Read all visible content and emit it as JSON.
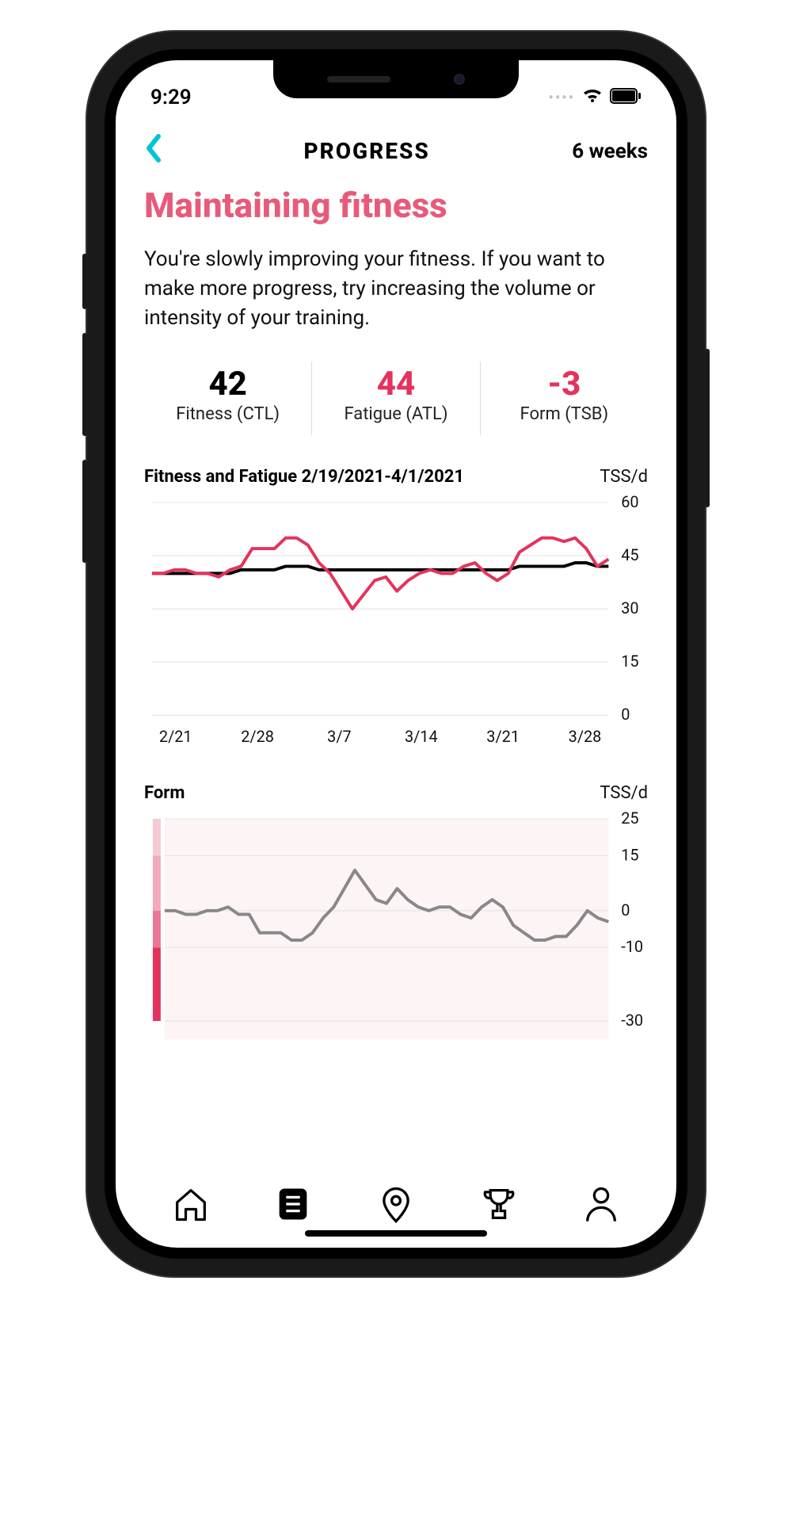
{
  "status": {
    "time": "9:29"
  },
  "nav": {
    "title": "PROGRESS",
    "range": "6 weeks"
  },
  "headline": "Maintaining fitness",
  "desc": "You're slowly improving your fitness. If you want to make more progress, try increasing the volume or intensity of your training.",
  "stats": {
    "fitness": {
      "val": "42",
      "lbl": "Fitness (CTL)"
    },
    "fatigue": {
      "val": "44",
      "lbl": "Fatigue (ATL)"
    },
    "form": {
      "val": "-3",
      "lbl": "Form (TSB)"
    }
  },
  "chart1": {
    "title": "Fitness and Fatigue 2/19/2021-4/1/2021",
    "unit": "TSS/d",
    "y": {
      "min": 0,
      "max": 60,
      "ticks": [
        0,
        15,
        30,
        45,
        60
      ]
    },
    "x": [
      "2/21",
      "2/28",
      "3/7",
      "3/14",
      "3/21",
      "3/28"
    ]
  },
  "chart2": {
    "title": "Form",
    "unit": "TSS/d",
    "y": {
      "ticks": [
        25,
        15,
        0,
        -10,
        -30
      ]
    }
  },
  "chart_data": [
    {
      "type": "line",
      "title": "Fitness and Fatigue 2/19/2021-4/1/2021",
      "ylabel": "TSS/d",
      "ylim": [
        0,
        60
      ],
      "y_ticks": [
        0,
        15,
        30,
        45,
        60
      ],
      "x_ticks": [
        "2/21",
        "2/28",
        "3/7",
        "3/14",
        "3/21",
        "3/28"
      ],
      "x": [
        "2/19",
        "2/20",
        "2/21",
        "2/22",
        "2/23",
        "2/24",
        "2/25",
        "2/26",
        "2/27",
        "2/28",
        "3/1",
        "3/2",
        "3/3",
        "3/4",
        "3/5",
        "3/6",
        "3/7",
        "3/8",
        "3/9",
        "3/10",
        "3/11",
        "3/12",
        "3/13",
        "3/14",
        "3/15",
        "3/16",
        "3/17",
        "3/18",
        "3/19",
        "3/20",
        "3/21",
        "3/22",
        "3/23",
        "3/24",
        "3/25",
        "3/26",
        "3/27",
        "3/28",
        "3/29",
        "3/30",
        "3/31",
        "4/1"
      ],
      "series": [
        {
          "name": "Fitness (CTL)",
          "color": "#000000",
          "values": [
            40,
            40,
            40,
            40,
            40,
            40,
            40,
            40,
            41,
            41,
            41,
            41,
            42,
            42,
            42,
            41,
            41,
            41,
            41,
            41,
            41,
            41,
            41,
            41,
            41,
            41,
            41,
            41,
            41,
            41,
            41,
            41,
            41,
            42,
            42,
            42,
            42,
            42,
            43,
            43,
            42,
            42
          ]
        },
        {
          "name": "Fatigue (ATL)",
          "color": "#e3335c",
          "values": [
            40,
            40,
            41,
            41,
            40,
            40,
            39,
            41,
            42,
            47,
            47,
            47,
            50,
            50,
            48,
            43,
            40,
            35,
            30,
            34,
            38,
            39,
            35,
            38,
            40,
            41,
            40,
            40,
            42,
            43,
            40,
            38,
            40,
            46,
            48,
            50,
            50,
            49,
            50,
            47,
            42,
            44
          ]
        }
      ]
    },
    {
      "type": "line",
      "title": "Form",
      "ylabel": "TSS/d",
      "ylim": [
        -35,
        25
      ],
      "y_ticks": [
        -30,
        -10,
        0,
        15,
        25
      ],
      "x": [
        "2/19",
        "2/20",
        "2/21",
        "2/22",
        "2/23",
        "2/24",
        "2/25",
        "2/26",
        "2/27",
        "2/28",
        "3/1",
        "3/2",
        "3/3",
        "3/4",
        "3/5",
        "3/6",
        "3/7",
        "3/8",
        "3/9",
        "3/10",
        "3/11",
        "3/12",
        "3/13",
        "3/14",
        "3/15",
        "3/16",
        "3/17",
        "3/18",
        "3/19",
        "3/20",
        "3/21",
        "3/22",
        "3/23",
        "3/24",
        "3/25",
        "3/26",
        "3/27",
        "3/28",
        "3/29",
        "3/30",
        "3/31",
        "3/31",
        "4/1"
      ],
      "series": [
        {
          "name": "Form (TSB)",
          "color": "#888888",
          "values": [
            0,
            0,
            -1,
            -1,
            0,
            0,
            1,
            -1,
            -1,
            -6,
            -6,
            -6,
            -8,
            -8,
            -6,
            -2,
            1,
            6,
            11,
            7,
            3,
            2,
            6,
            3,
            1,
            0,
            1,
            1,
            -1,
            -2,
            1,
            3,
            1,
            -4,
            -6,
            -8,
            -8,
            -7,
            -7,
            -4,
            0,
            -2,
            -3
          ]
        }
      ],
      "scale_bands": [
        {
          "from": 25,
          "to": 15,
          "color": "#f6c9d4"
        },
        {
          "from": 15,
          "to": 0,
          "color": "#f2a9bc"
        },
        {
          "from": 0,
          "to": -10,
          "color": "#ea7797"
        },
        {
          "from": -10,
          "to": -30,
          "color": "#e3335c"
        }
      ]
    }
  ]
}
